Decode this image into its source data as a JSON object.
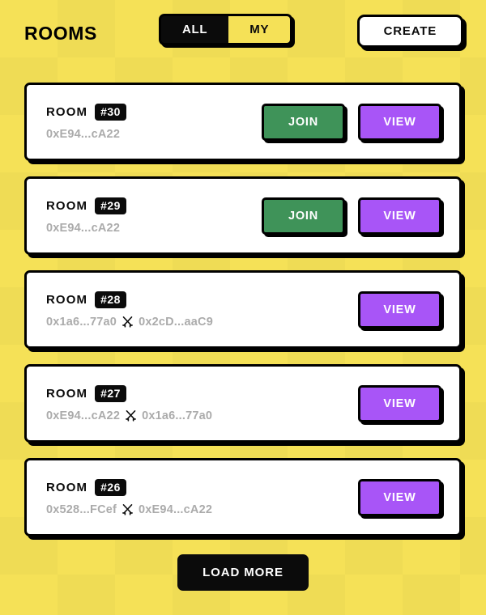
{
  "header": {
    "title": "ROOMS",
    "filter": {
      "options": [
        {
          "label": "ALL",
          "selected": true
        },
        {
          "label": "MY",
          "selected": false
        }
      ]
    },
    "create_label": "CREATE"
  },
  "rooms": [
    {
      "room_word": "ROOM",
      "badge": "#30",
      "players": [
        "0xE94...cA22"
      ],
      "vs_icon": "crossed-swords-icon",
      "actions": [
        {
          "label": "JOIN",
          "kind": "join"
        },
        {
          "label": "VIEW",
          "kind": "view"
        }
      ]
    },
    {
      "room_word": "ROOM",
      "badge": "#29",
      "players": [
        "0xE94...cA22"
      ],
      "vs_icon": "crossed-swords-icon",
      "actions": [
        {
          "label": "JOIN",
          "kind": "join"
        },
        {
          "label": "VIEW",
          "kind": "view"
        }
      ]
    },
    {
      "room_word": "ROOM",
      "badge": "#28",
      "players": [
        "0x1a6...77a0",
        "0x2cD...aaC9"
      ],
      "vs_icon": "crossed-swords-icon",
      "actions": [
        {
          "label": "VIEW",
          "kind": "view"
        }
      ]
    },
    {
      "room_word": "ROOM",
      "badge": "#27",
      "players": [
        "0xE94...cA22",
        "0x1a6...77a0"
      ],
      "vs_icon": "crossed-swords-icon",
      "actions": [
        {
          "label": "VIEW",
          "kind": "view"
        }
      ]
    },
    {
      "room_word": "ROOM",
      "badge": "#26",
      "players": [
        "0x528...FCef",
        "0xE94...cA22"
      ],
      "vs_icon": "crossed-swords-icon",
      "actions": [
        {
          "label": "VIEW",
          "kind": "view"
        }
      ]
    }
  ],
  "footer": {
    "load_more_label": "LOAD MORE"
  },
  "colors": {
    "background_yellow": "#F5E157",
    "black": "#0B0B0B",
    "white": "#FFFFFF",
    "join_green": "#3F9359",
    "view_purple": "#A855F7",
    "address_gray": "#ABABAB"
  }
}
